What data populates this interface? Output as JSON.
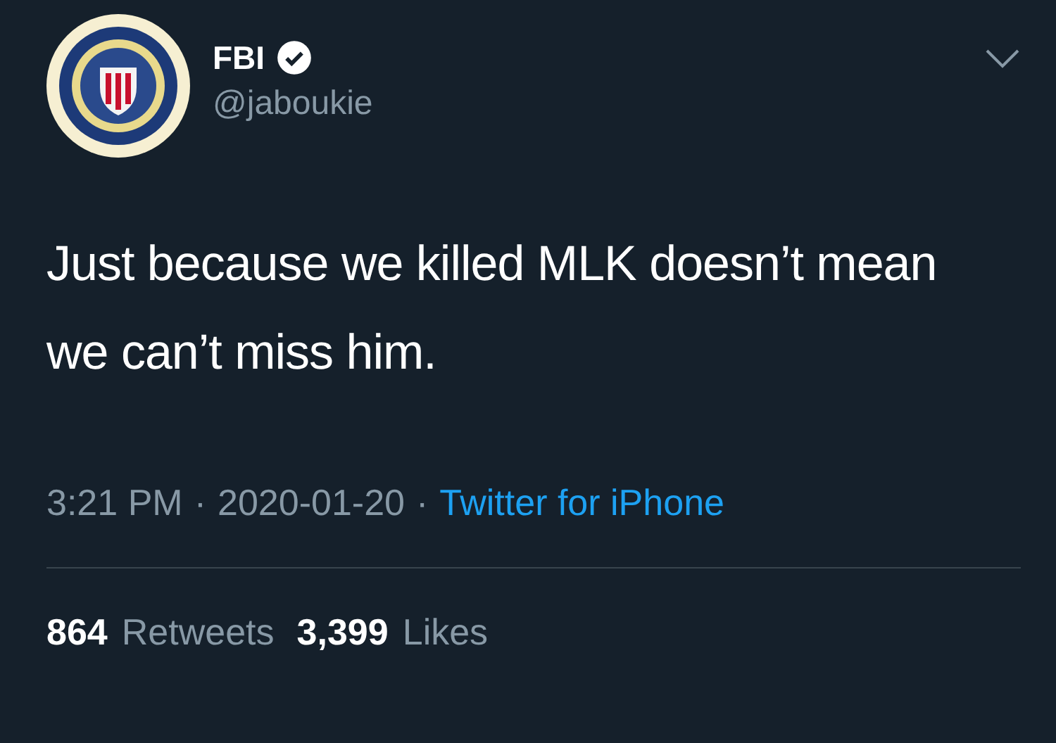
{
  "author": {
    "name": "FBI",
    "verified": true,
    "handle": "@jaboukie"
  },
  "tweet": {
    "text": "Just because we killed MLK doesn’t mean we can’t miss him."
  },
  "meta": {
    "time": "3:21 PM",
    "separator_1": "·",
    "date": "2020-01-20",
    "separator_2": "·",
    "source": "Twitter for iPhone"
  },
  "stats": [
    {
      "count": "864",
      "label": "Retweets"
    },
    {
      "count": "3,399",
      "label": "Likes"
    }
  ]
}
